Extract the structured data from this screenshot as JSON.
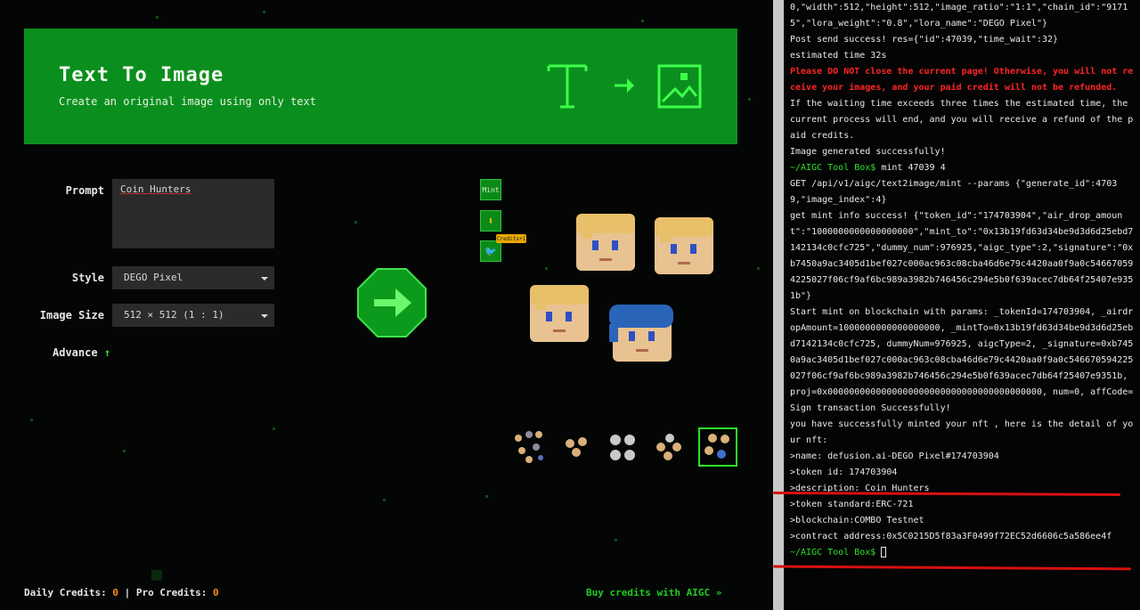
{
  "hero": {
    "title": "Text To Image",
    "subtitle": "Create an original image using only text"
  },
  "form": {
    "prompt_label": "Prompt",
    "prompt_value": "Coin Hunters",
    "style_label": "Style",
    "style_value": "DEGO Pixel",
    "size_label": "Image Size",
    "size_value": "512 × 512 (1 : 1)",
    "advance_label": "Advance",
    "advance_icon": "arrow-up-icon"
  },
  "actions": {
    "mint_label": "Mint",
    "download_icon": "download-icon",
    "twitter_icon": "twitter-icon",
    "tooltip": "Credits+1",
    "generate_icon": "arrow-right-icon"
  },
  "footer": {
    "daily_label": "Daily Credits:",
    "daily_value": "0",
    "separator": "|",
    "pro_label": "Pro Credits:",
    "pro_value": "0",
    "buy_text": "Buy credits with AIGC »"
  },
  "colors": {
    "accent": "#0a8f1e",
    "bright": "#2ee02e",
    "credit": "#ff8c1a",
    "warning": "#ff2424",
    "highlight": "#d81010"
  },
  "terminal": {
    "lines": [
      {
        "t": "0,\"width\":512,\"height\":512,\"image_ratio\":\"1:1\",\"chain_id\":\"91715\",\"lora_weight\":\"0.8\",\"lora_name\":\"DEGO Pixel\"}"
      },
      {
        "t": "Post send success! res={\"id\":47039,\"time_wait\":32}"
      },
      {
        "t": "estimated time 32s"
      },
      {
        "t": "Please DO NOT close the current page! Otherwise, you will not receive your images, and your paid credit will not be refunded.",
        "c": "warn"
      },
      {
        "t": "If the waiting time exceeds three times the estimated time, the current process will end, and you will receive a refund of the paid credits."
      },
      {
        "t": "Image generated successfully!"
      },
      {
        "t": "mint 47039 4",
        "p": "~/AIGC Tool Box$ "
      },
      {
        "t": "GET /api/v1/aigc/text2image/mint --params {\"generate_id\":47039,\"image_index\":4}"
      },
      {
        "t": "get mint info success! {\"token_id\":\"174703904\",\"air_drop_amount\":\"1000000000000000000\",\"mint_to\":\"0x13b19fd63d34be9d3d6d25ebd7142134c0cfc725\",\"dummy_num\":976925,\"aigc_type\":2,\"signature\":\"0xb7450a9ac3405d1bef027c000ac963c08cba46d6e79c4420aa0f9a0c546670594225027f06cf9af6bc989a3982b746456c294e5b0f639acec7db64f25407e9351b\"}"
      },
      {
        "t": "Start mint on blockchain with params: _tokenId=174703904, _airdropAmount=1000000000000000000, _mintTo=0x13b19fd63d34be9d3d6d25ebd7142134c0cfc725, dummyNum=976925, aigcType=2, _signature=0xb7450a9ac3405d1bef027c000ac963c08cba46d6e79c4420aa0f9a0c546670594225027f06cf9af6bc989a3982b746456c294e5b0f639acec7db64f25407e9351b, proj=0x0000000000000000000000000000000000000000, num=0, affCode="
      },
      {
        "t": "Sign transaction Successfully!"
      },
      {
        "t": "you have successfully minted your nft , here is the detail of your nft:"
      },
      {
        "t": ">name: defusion.ai-DEGO Pixel#174703904"
      },
      {
        "t": ">token id: 174703904"
      },
      {
        "t": ">description: Coin Hunters"
      },
      {
        "t": ">token standard:ERC-721"
      },
      {
        "t": ">blockchain:COMBO Testnet"
      },
      {
        "t": ">contract address:0x5C0215D5f83a3F0499f72EC52d6606c5a586ee4f"
      },
      {
        "t": "",
        "p": "~/AIGC Tool Box$ "
      }
    ]
  }
}
